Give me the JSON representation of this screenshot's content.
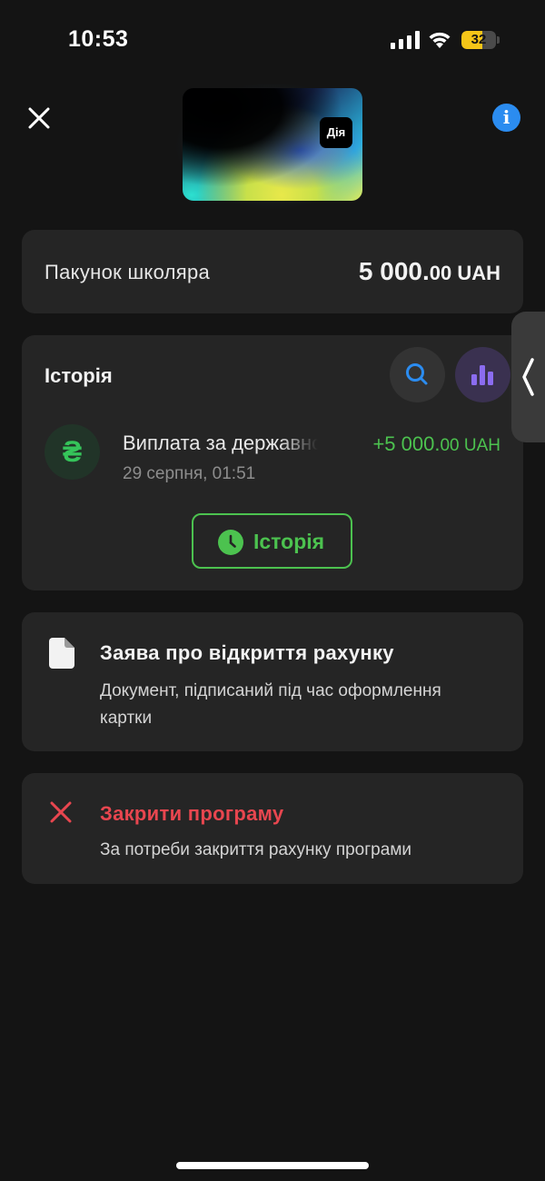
{
  "status_bar": {
    "time": "10:53",
    "battery_level": "32",
    "battery_color": "#f5c518"
  },
  "header": {
    "close_icon": "close-icon",
    "info_icon": "info-icon",
    "info_glyph": "i",
    "card_logo": "Дія"
  },
  "balance": {
    "label": "Пакунок школяра",
    "amount_main": "5 000.",
    "amount_cents": "00 UAH"
  },
  "history": {
    "title": "Історія",
    "search_icon": "search-icon",
    "chart_icon": "bar-chart-icon",
    "transactions": [
      {
        "avatar_glyph": "₴",
        "title": "Виплата за державною програмою",
        "date": "29 серпня, 01:51",
        "amount_main": "+5 000.",
        "amount_cents": "00 UAH",
        "amount_color": "#4cc24f"
      }
    ],
    "button_label": "Історія",
    "button_icon": "clock-icon"
  },
  "document": {
    "icon": "document-icon",
    "title": "Заява про відкриття рахунку",
    "description": "Документ, підписаний під час оформлення картки"
  },
  "close_program": {
    "icon": "close-x-icon",
    "title": "Закрити програму",
    "description": "За потреби закриття рахунку програми",
    "color": "#e8464f"
  },
  "accent_green": "#4cc24f",
  "accent_blue": "#2b8cf0"
}
